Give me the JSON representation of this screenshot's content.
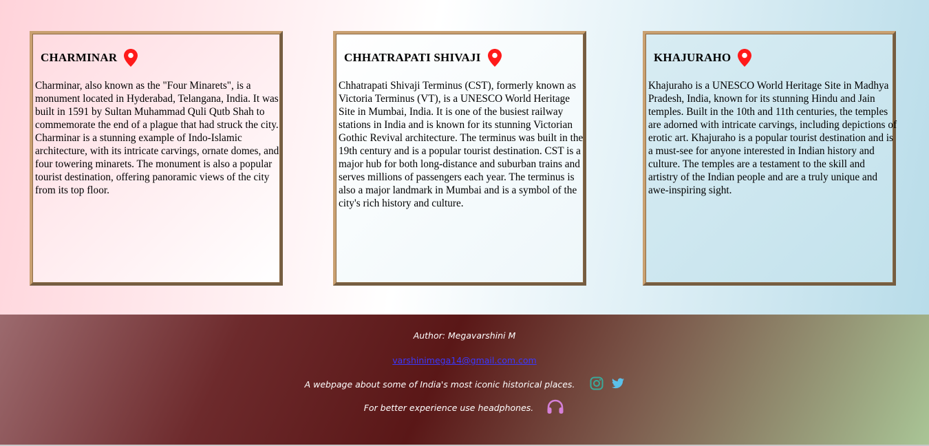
{
  "cards": [
    {
      "title": "CHARMINAR",
      "text": " Charminar, also known as the \"Four Minarets\", is a monument located in Hyderabad, Telangana, India. It was built in 1591 by Sultan Muhammad Quli Qutb Shah to commemorate the end of a plague that had struck the city. Charminar is a stunning example of Indo-Islamic architecture, with its intricate carvings, ornate domes, and four towering minarets. The monument is also a popular tourist destination, offering panoramic views of the city from its top floor."
    },
    {
      "title": "CHHATRAPATI SHIVAJI",
      "text": " Chhatrapati Shivaji Terminus (CST), formerly known as Victoria Terminus (VT), is a UNESCO World Heritage Site in Mumbai, India. It is one of the busiest railway stations in India and is known for its stunning Victorian Gothic Revival architecture. The terminus was built in the 19th century and is a popular tourist destination. CST is a major hub for both long-distance and suburban trains and serves millions of passengers each year. The terminus is also a major landmark in Mumbai and is a symbol of the city's rich history and culture."
    },
    {
      "title": "KHAJURAHO",
      "text": " Khajuraho is a UNESCO World Heritage Site in Madhya Pradesh, India, known for its stunning Hindu and Jain temples. Built in the 10th and 11th centuries, the temples are adorned with intricate carvings, including depictions of erotic art. Khajuraho is a popular tourist destination and is a must-see for anyone interested in Indian history and culture. The temples are a testament to the skill and artistry of the Indian people and are a truly unique and awe-inspiring sight."
    }
  ],
  "footer": {
    "author": "Author: Megavarshini M",
    "email": "varshinimega14@gmail.com.com",
    "description": "A webpage about some of India's most iconic historical places.",
    "tip": "For better experience use headphones."
  },
  "icons": {
    "location": "location-pin-icon",
    "instagram": "instagram-icon",
    "twitter": "twitter-icon",
    "headphones": "headphones-icon"
  },
  "colors": {
    "pin": "#ff1a1a",
    "card_border": "#c9a071",
    "instagram": "#3aa99a",
    "twitter": "#5bc0ea",
    "headphones": "#d580d8",
    "email_link": "#3b38ff"
  }
}
